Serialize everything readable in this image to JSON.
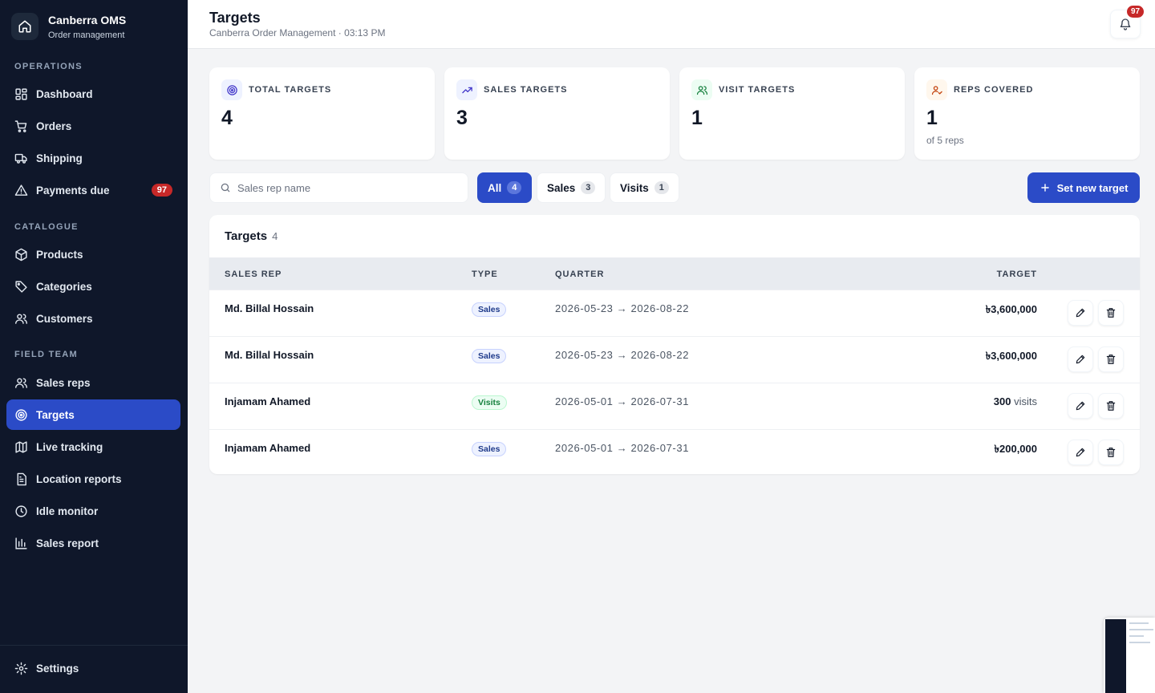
{
  "app": {
    "name": "Canberra OMS",
    "subtitle": "Order management"
  },
  "sidebar": {
    "sections": [
      {
        "label": "OPERATIONS",
        "items": [
          {
            "label": "Dashboard",
            "icon": "grid-icon"
          },
          {
            "label": "Orders",
            "icon": "cart-icon"
          },
          {
            "label": "Shipping",
            "icon": "truck-icon"
          },
          {
            "label": "Payments due",
            "icon": "alert-triangle-icon",
            "badge": "97"
          }
        ]
      },
      {
        "label": "CATALOGUE",
        "items": [
          {
            "label": "Products",
            "icon": "box-icon"
          },
          {
            "label": "Categories",
            "icon": "tag-icon"
          },
          {
            "label": "Customers",
            "icon": "users-icon"
          }
        ]
      },
      {
        "label": "FIELD TEAM",
        "items": [
          {
            "label": "Sales reps",
            "icon": "users-icon"
          },
          {
            "label": "Targets",
            "icon": "target-icon",
            "active": true
          },
          {
            "label": "Live tracking",
            "icon": "map-icon"
          },
          {
            "label": "Location reports",
            "icon": "file-icon"
          },
          {
            "label": "Idle monitor",
            "icon": "clock-icon"
          },
          {
            "label": "Sales report",
            "icon": "bar-chart-icon"
          }
        ]
      }
    ],
    "settings_label": "Settings"
  },
  "header": {
    "title": "Targets",
    "subtitle": "Canberra Order Management · 03:13 PM",
    "notification_count": "97"
  },
  "stats": [
    {
      "label": "TOTAL TARGETS",
      "value": "4",
      "icon": "target-icon",
      "color": "#4338ca",
      "bg": "#eef2ff"
    },
    {
      "label": "SALES TARGETS",
      "value": "3",
      "icon": "trending-up-icon",
      "color": "#4338ca",
      "bg": "#eef2ff"
    },
    {
      "label": "VISIT TARGETS",
      "value": "1",
      "icon": "users-icon",
      "color": "#15803d",
      "bg": "#ecfdf3"
    },
    {
      "label": "REPS COVERED",
      "value": "1",
      "note": "of 5 reps",
      "icon": "user-check-icon",
      "color": "#c2410c",
      "bg": "#fff7ed"
    }
  ],
  "search": {
    "placeholder": "Sales rep name",
    "value": ""
  },
  "filters": [
    {
      "label": "All",
      "count": "4",
      "active": true
    },
    {
      "label": "Sales",
      "count": "3"
    },
    {
      "label": "Visits",
      "count": "1"
    }
  ],
  "actions": {
    "new_target_label": "Set new target"
  },
  "table": {
    "title": "Targets",
    "count": "4",
    "columns": {
      "rep": "SALES REP",
      "type": "TYPE",
      "quarter": "QUARTER",
      "target": "TARGET"
    },
    "rows": [
      {
        "rep": "Md. Billal Hossain",
        "type": "Sales",
        "quarter": "2026-05-23 → 2026-08-22",
        "target": "৳3,600,000",
        "unit": ""
      },
      {
        "rep": "Md. Billal Hossain",
        "type": "Sales",
        "quarter": "2026-05-23 → 2026-08-22",
        "target": "৳3,600,000",
        "unit": ""
      },
      {
        "rep": "Injamam Ahamed",
        "type": "Visits",
        "quarter": "2026-05-01 → 2026-07-31",
        "target": "300",
        "unit": "visits"
      },
      {
        "rep": "Injamam Ahamed",
        "type": "Sales",
        "quarter": "2026-05-01 → 2026-07-31",
        "target": "৳200,000",
        "unit": ""
      }
    ]
  },
  "colors": {
    "sidebar_bg": "#0f172a",
    "accent": "#2b4bc7",
    "badge": "#c62828"
  }
}
